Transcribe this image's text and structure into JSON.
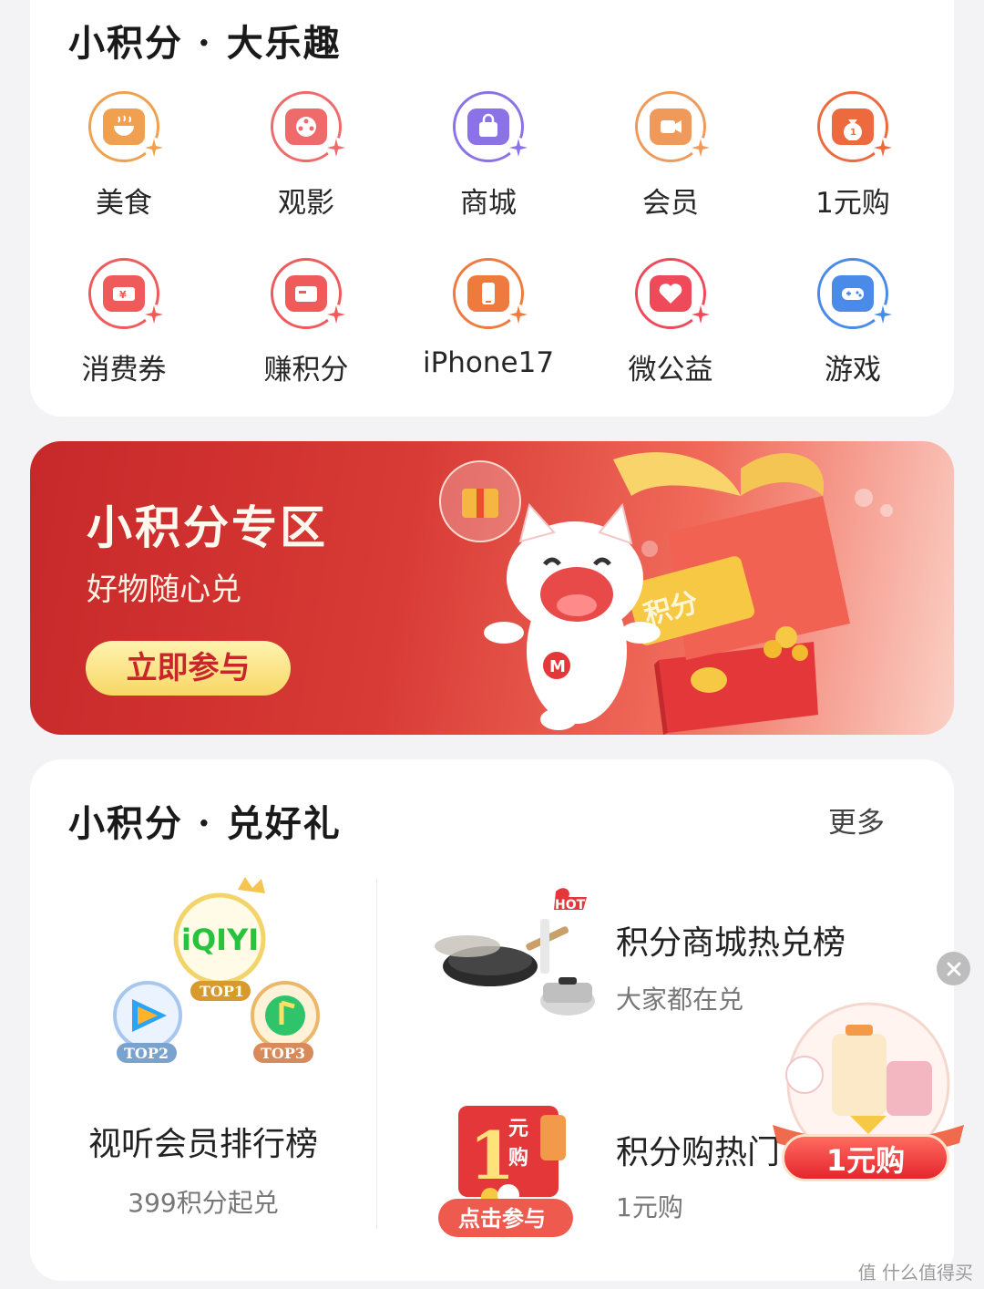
{
  "fun_section": {
    "title": "小积分 · 大乐趣",
    "categories": [
      {
        "label": "美食",
        "icon": "food-bowl-icon",
        "color": "#f0a04e"
      },
      {
        "label": "观影",
        "icon": "film-reel-icon",
        "color": "#ef6a6a"
      },
      {
        "label": "商城",
        "icon": "shopping-bag-icon",
        "color": "#8b72e6"
      },
      {
        "label": "会员",
        "icon": "video-camera-icon",
        "color": "#ef9a5a"
      },
      {
        "label": "1元购",
        "icon": "money-bag-icon",
        "color": "#ec6a3e"
      },
      {
        "label": "消费券",
        "icon": "coupon-icon",
        "color": "#ef5a5a"
      },
      {
        "label": "赚积分",
        "icon": "card-icon",
        "color": "#ef5a5a"
      },
      {
        "label": "iPhone17",
        "icon": "phone-icon",
        "color": "#ef7a3e"
      },
      {
        "label": "微公益",
        "icon": "heart-icon",
        "color": "#ef4a5a"
      },
      {
        "label": "游戏",
        "icon": "gamepad-icon",
        "color": "#4a8ae8"
      }
    ]
  },
  "banner": {
    "title": "小积分专区",
    "subtitle": "好物随心兑",
    "button_label": "立即参与",
    "ticket_text": "积分"
  },
  "gifts_section": {
    "title": "小积分 · 兑好礼",
    "more_label": "更多",
    "av_rank": {
      "name": "视听会员排行榜",
      "subtitle": "399积分起兑",
      "badges": [
        "TOP1",
        "TOP2",
        "TOP3"
      ],
      "logo_text": "iQIYI"
    },
    "hot_exchange": {
      "title": "积分商城热兑榜",
      "subtitle": "大家都在兑",
      "badge": "HOT"
    },
    "hot_buy": {
      "title": "积分购热门",
      "subtitle": "1元购",
      "badge_top": "元",
      "badge_bottom": "购",
      "badge_num": "1",
      "cta": "点击参与"
    }
  },
  "floating_promo": {
    "button_label": "1元购"
  },
  "watermark": "值 什么值得买",
  "colors": {
    "accent_red": "#d83a35",
    "button_yellow": "#f8d766",
    "banner_text": "#fff8ee"
  }
}
